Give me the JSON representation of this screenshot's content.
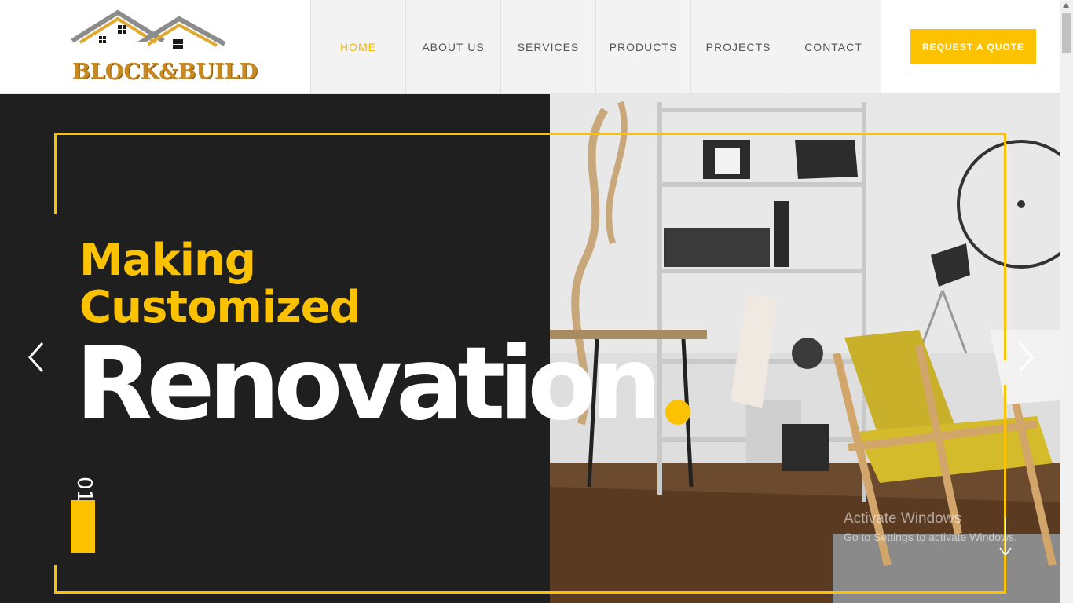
{
  "brand": {
    "name": "BLOCK & BUILD",
    "logo_text": "BLOCK&BUILD",
    "color": "#c8891f"
  },
  "nav": {
    "items": [
      {
        "label": "HOME",
        "active": true
      },
      {
        "label": "ABOUT US",
        "active": false
      },
      {
        "label": "SERVICES",
        "active": false
      },
      {
        "label": "PRODUCTS",
        "active": false
      },
      {
        "label": "PROJECTS",
        "active": false
      },
      {
        "label": "CONTACT",
        "active": false
      }
    ],
    "cta_label": "REQUEST A QUOTE"
  },
  "hero": {
    "line1": "Making",
    "line2": "Customized",
    "big_word": "Renovation",
    "slide_number": "01",
    "prev_icon": "chevron-left-icon",
    "next_icon": "chevron-right-icon",
    "scroll_icon": "arrow-down-icon"
  },
  "watermark": {
    "line1": "Activate Windows",
    "line2": "Go to Settings to activate Windows."
  },
  "colors": {
    "accent": "#fcc200",
    "dark": "#1f1f1f",
    "active_nav": "#f5b800"
  }
}
